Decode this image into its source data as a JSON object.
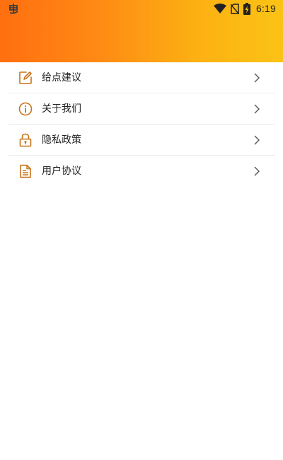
{
  "status_bar": {
    "time": "6:19",
    "icons": [
      "bug-app-icon",
      "wifi-icon",
      "no-sim-icon",
      "battery-charging-icon"
    ]
  },
  "header": {
    "gradient_colors": [
      "#ff6f10",
      "#fbc314"
    ]
  },
  "menu": {
    "icon_color": "#c8741a",
    "items": [
      {
        "label": "给点建议",
        "icon": "edit-icon"
      },
      {
        "label": "关于我们",
        "icon": "info-icon"
      },
      {
        "label": "隐私政策",
        "icon": "lock-icon"
      },
      {
        "label": "用户协议",
        "icon": "document-icon"
      }
    ]
  }
}
